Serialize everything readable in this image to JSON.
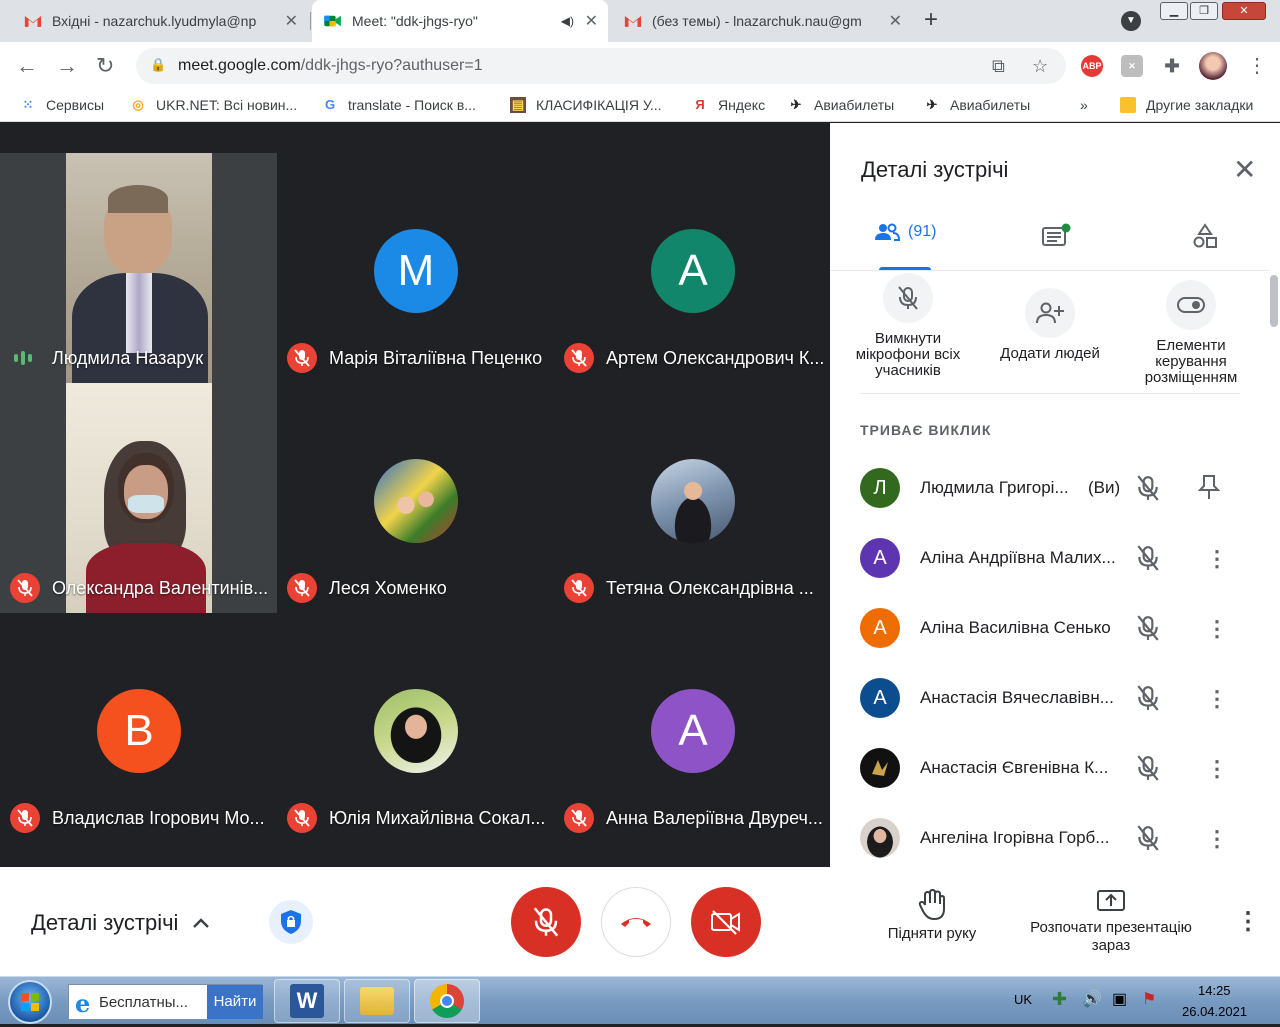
{
  "browser": {
    "tabs": [
      {
        "title": "Вхідні - nazarchuk.lyudmyla@np",
        "icon": "gmail-icon"
      },
      {
        "title": "Meet: \"ddk-jhgs-ryo\"",
        "icon": "meet-icon"
      },
      {
        "title": "(без темы) - lnazarchuk.nau@gm",
        "icon": "gmail-icon"
      }
    ],
    "url_host": "meet.google.com",
    "url_path": "/ddk-jhgs-ryo?authuser=1",
    "bookmarks": [
      "Сервисы",
      "UKR.NET: Всі новин...",
      "translate - Поиск в...",
      "КЛАСИФІКАЦІЯ У...",
      "Яндекс",
      "Авиабилеты",
      "Авиабилеты",
      "Другие закладки"
    ],
    "bookmarks_more": "»",
    "abp_label": "ABP"
  },
  "tiles": [
    {
      "name": "Людмила Назарук",
      "type": "video",
      "speaking": true
    },
    {
      "name": "Марія Віталіївна Пеценко",
      "type": "letter",
      "letter": "M",
      "color": "#1a8ae6"
    },
    {
      "name": "Артем Олександрович К...",
      "type": "letter",
      "letter": "A",
      "color": "#12866a"
    },
    {
      "name": "Олександра Валентинів...",
      "type": "video"
    },
    {
      "name": "Леся Хоменко",
      "type": "photo"
    },
    {
      "name": "Тетяна Олександрівна ...",
      "type": "photo"
    },
    {
      "name": "Владислав Ігорович Мо...",
      "type": "letter",
      "letter": "B",
      "color": "#f4511e"
    },
    {
      "name": "Юлія Михайлівна Сокал...",
      "type": "photo"
    },
    {
      "name": "Анна Валеріївна Двуреч...",
      "type": "letter",
      "letter": "A",
      "color": "#8e54c7"
    }
  ],
  "panel": {
    "title": "Деталі зустрічі",
    "people_count": "(91)",
    "actions": [
      {
        "label": "Вимкнути мікрофони всіх учасників"
      },
      {
        "label": "Додати людей"
      },
      {
        "label": "Елементи керування розміщенням"
      }
    ],
    "section_header": "ТРИВАЄ ВИКЛИК",
    "you_label": "(Ви)",
    "participants": [
      {
        "name": "Людмила Григорі...",
        "letter": "Л",
        "color": "#33691e",
        "self": true
      },
      {
        "name": "Аліна Андріївна Малих...",
        "letter": "A",
        "color": "#5e35b1"
      },
      {
        "name": "Аліна Василівна Сенько",
        "letter": "A",
        "color": "#ef6c00"
      },
      {
        "name": "Анастасія Вячеславівн...",
        "letter": "A",
        "color": "#0b4d8f"
      },
      {
        "name": "Анастасія Євгенівна К...",
        "letter": "",
        "color": "#111111"
      },
      {
        "name": "Ангеліна Ігорівна Горб...",
        "letter": "",
        "color": "#d9d2cc"
      }
    ]
  },
  "bottom": {
    "meeting_details": "Деталі зустрічі",
    "raise_hand": "Підняти руку",
    "present": "Розпочати презентацію зараз"
  },
  "taskbar": {
    "search_text": "Бесплатны...",
    "search_button": "Найти",
    "lang": "UK",
    "time": "14:25",
    "date": "26.04.2021"
  }
}
